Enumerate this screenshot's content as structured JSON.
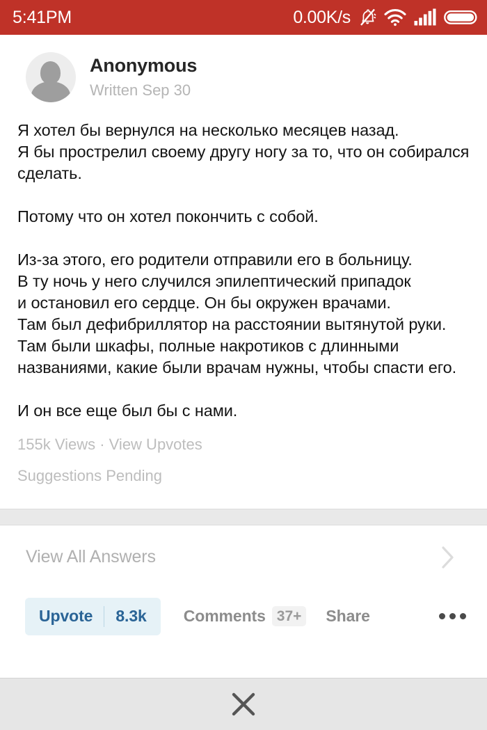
{
  "status_bar": {
    "time": "5:41PM",
    "network_speed": "0.00K/s",
    "background_color": "#bf3228",
    "icons": [
      "bell-muted-icon",
      "wifi-icon",
      "signal-bars-icon",
      "battery-icon"
    ]
  },
  "answer": {
    "author_name": "Anonymous",
    "written_date": "Written Sep 30",
    "avatar": "default-user-avatar",
    "paragraphs": [
      "Я хотел бы вернулся на несколько месяцев назад.\nЯ бы прострелил своему другу ногу за то, что он собирался сделать.",
      "Потому что он хотел покончить с собой.",
      "Из-за этого, его родители отправили его в больницу.\nВ ту ночь у него случился эпилептический припадок\nи остановил его сердце. Он бы окружен врачами.\nТам был дефибриллятор на расстоянии вытянутой руки.\nТам были шкафы, полные накротиков с длинными\nназваниями, какие были врачам нужны, чтобы спасти его.",
      "И он все еще был бы с нами."
    ],
    "views_line": "155k Views · View Upvotes",
    "suggestions_line": "Suggestions Pending"
  },
  "view_all": {
    "label": "View All Answers",
    "chevron": "chevron-right-icon"
  },
  "action_bar": {
    "upvote_label": "Upvote",
    "upvote_count": "8.3k",
    "upvote_color": "#2a6496",
    "upvote_background": "#e6f2f7",
    "comments_label": "Comments",
    "comments_count": "37+",
    "share_label": "Share",
    "more_icon": "more-horizontal-icon"
  },
  "bottom_bar": {
    "close_icon": "close-x-icon",
    "background_color": "#e6e6e6"
  }
}
